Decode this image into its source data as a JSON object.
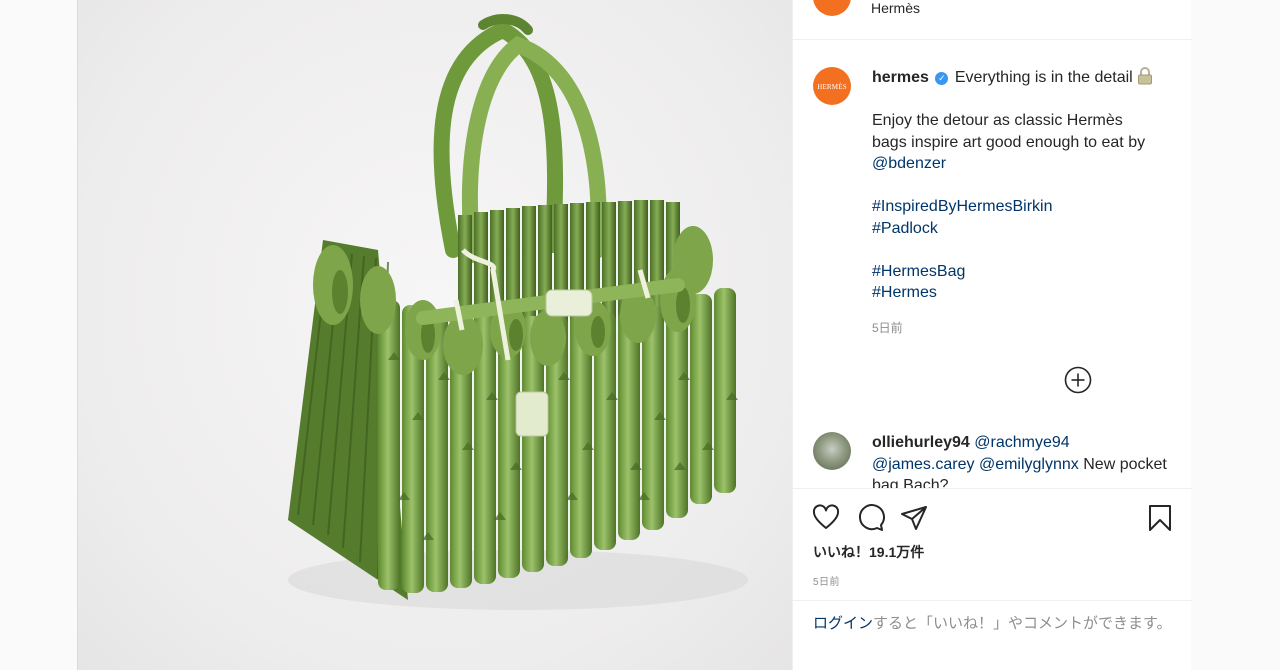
{
  "header": {
    "account_name": "Hermès"
  },
  "post": {
    "username": "hermes",
    "verified": true,
    "caption_title": "Everything is in the detail",
    "caption_line1": "Enjoy the detour as classic Hermès",
    "caption_line2": "bags inspire art good enough to eat by",
    "mention": "@bdenzer",
    "hashtags_group1": [
      "#InspiredByHermesBirkin",
      "#Padlock"
    ],
    "hashtags_group2": [
      "#HermesBag",
      "#Hermes"
    ],
    "time_ago": "5日前",
    "avatar_logo": "HERMÈS",
    "avatar_color": "#f37021"
  },
  "load_more": {
    "icon": "plus-circle-icon"
  },
  "comment": {
    "username": "olliehurley94",
    "mentions": [
      "@rachmye94",
      "@james.carey",
      "@emilyglynnx"
    ],
    "text_visible": "New",
    "text_cut": "pocket bag Bach?"
  },
  "actions": {
    "icons": [
      "heart-icon",
      "comment-icon",
      "share-icon",
      "bookmark-icon"
    ],
    "likes": "いいね！19.1万件",
    "time_ago": "5日前"
  },
  "login_prompt": {
    "link": "ログイン",
    "rest": "すると「いいね！」やコメントができます。"
  },
  "colors": {
    "link": "#003569",
    "muted": "#8e8e8e",
    "brand_orange": "#f37021",
    "asparagus": "#7da24a"
  }
}
